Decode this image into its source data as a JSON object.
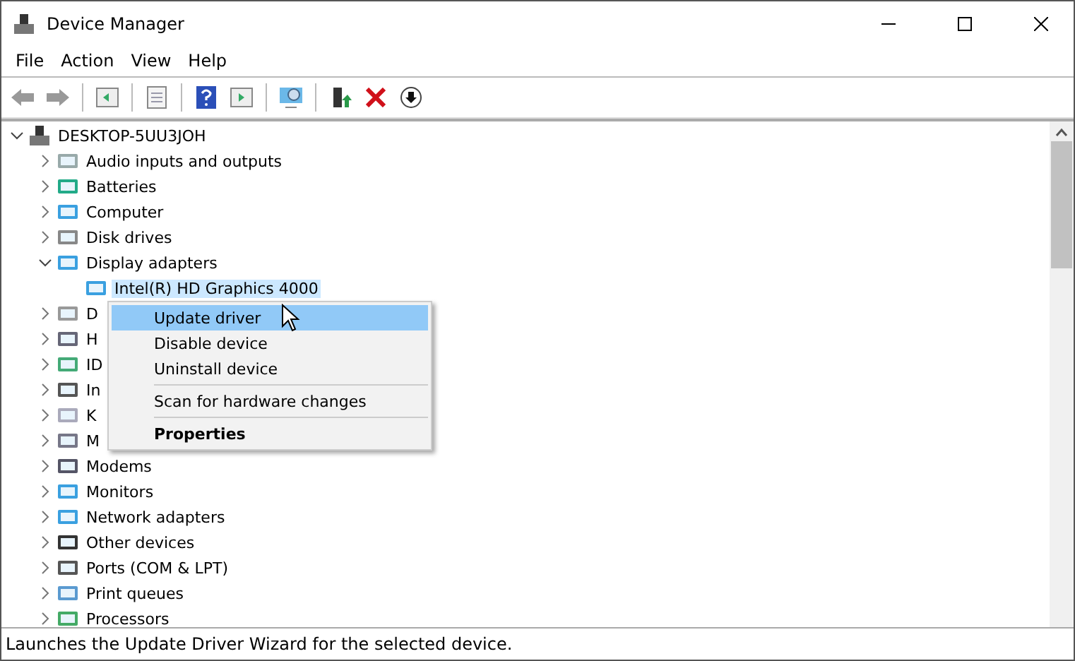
{
  "window": {
    "title": "Device Manager"
  },
  "menu_bar": [
    "File",
    "Action",
    "View",
    "Help"
  ],
  "tree": {
    "label": "DESKTOP-5UU3JOH",
    "expanded": true,
    "children": [
      {
        "label": "Audio inputs and outputs",
        "expanded": false,
        "selected": false
      },
      {
        "label": "Batteries",
        "expanded": false,
        "selected": false
      },
      {
        "label": "Computer",
        "expanded": false,
        "selected": false
      },
      {
        "label": "Disk drives",
        "expanded": false,
        "selected": false
      },
      {
        "label": "Display adapters",
        "expanded": true,
        "selected": false,
        "children": [
          {
            "label": "Intel(R) HD Graphics 4000",
            "selected": true
          }
        ]
      },
      {
        "label": "D",
        "expanded": false,
        "selected": false
      },
      {
        "label": "H",
        "expanded": false,
        "selected": false
      },
      {
        "label": "ID",
        "expanded": false,
        "selected": false
      },
      {
        "label": "In",
        "expanded": false,
        "selected": false
      },
      {
        "label": "K",
        "expanded": false,
        "selected": false
      },
      {
        "label": "M",
        "expanded": false,
        "selected": false
      },
      {
        "label": "Modems",
        "expanded": false,
        "selected": false
      },
      {
        "label": "Monitors",
        "expanded": false,
        "selected": false
      },
      {
        "label": "Network adapters",
        "expanded": false,
        "selected": false
      },
      {
        "label": "Other devices",
        "expanded": false,
        "selected": false
      },
      {
        "label": "Ports (COM & LPT)",
        "expanded": false,
        "selected": false
      },
      {
        "label": "Print queues",
        "expanded": false,
        "selected": false
      },
      {
        "label": "Processors",
        "expanded": false,
        "selected": false
      }
    ]
  },
  "context_menu": [
    {
      "kind": "item",
      "label": "Update driver",
      "selected": true
    },
    {
      "kind": "item",
      "label": "Disable device",
      "selected": false
    },
    {
      "kind": "item",
      "label": "Uninstall device",
      "selected": false
    },
    {
      "kind": "separator"
    },
    {
      "kind": "item",
      "label": "Scan for hardware changes",
      "selected": false
    },
    {
      "kind": "separator"
    },
    {
      "kind": "default",
      "label": "Properties",
      "selected": false
    }
  ],
  "status_bar": "Launches the Update Driver Wizard for the selected device."
}
